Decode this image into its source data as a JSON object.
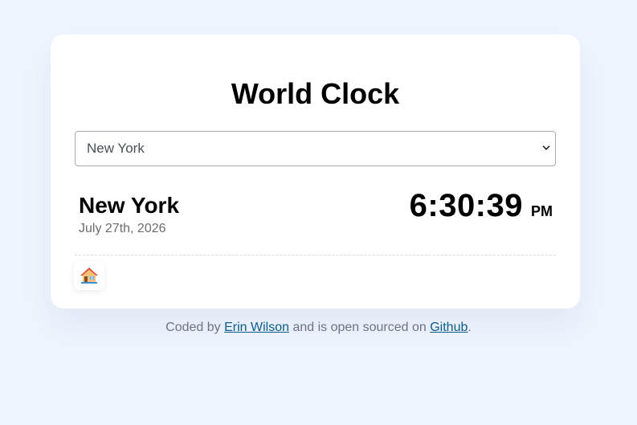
{
  "app": {
    "title": "World Clock"
  },
  "city_select": {
    "selected": "New York"
  },
  "clock": {
    "city": "New York",
    "date": "July 27th, 2026",
    "time": "6:30:39",
    "ampm": "PM"
  },
  "home": {
    "icon": "house-icon"
  },
  "footer": {
    "prefix": "Coded by ",
    "author_link": "Erin Wilson",
    "middle": " and is open sourced on ",
    "repo_link": "Github",
    "suffix": "."
  },
  "colors": {
    "background": "#eff5fe",
    "card": "#ffffff",
    "link": "#0a5c8a",
    "muted_text": "#6c757d"
  }
}
